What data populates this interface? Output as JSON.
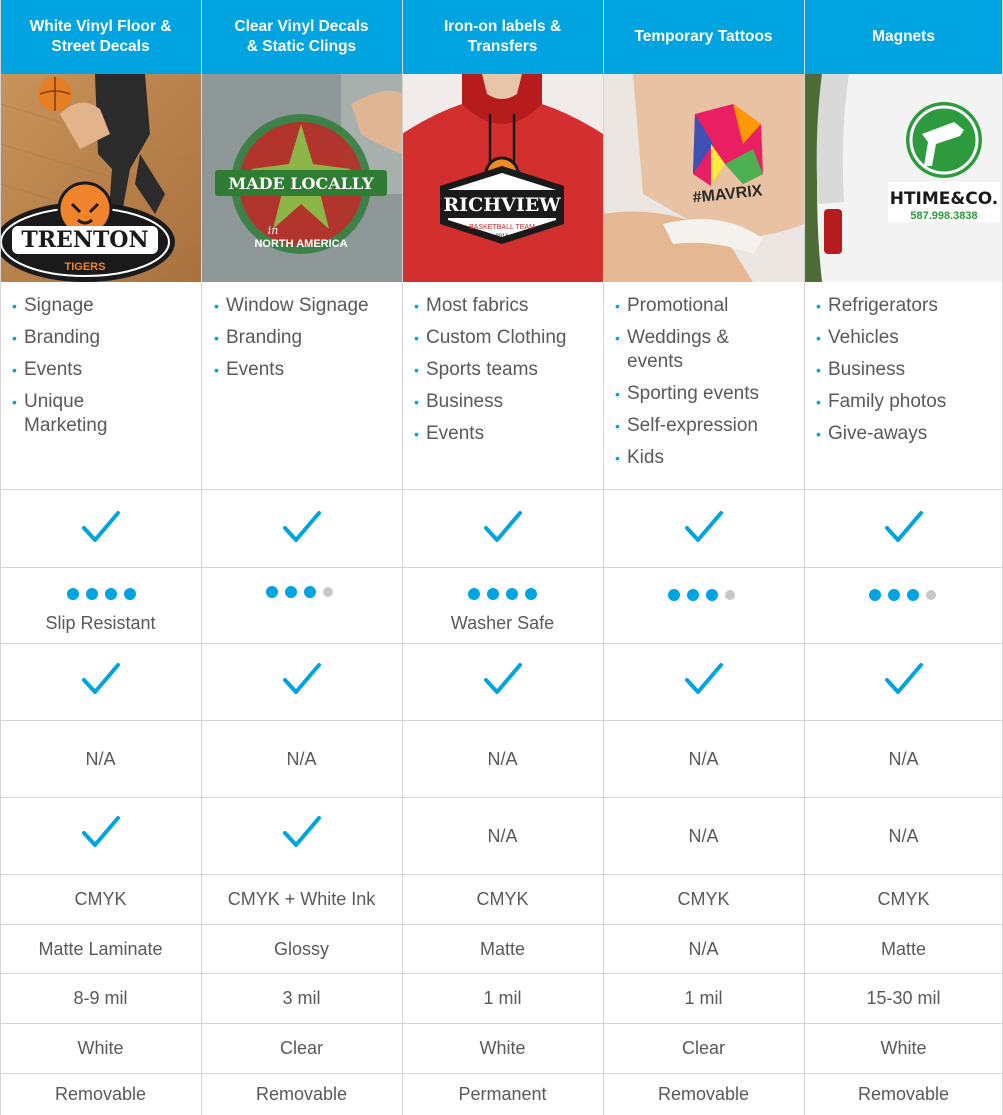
{
  "accent_color": "#00a4e0",
  "columns": [
    {
      "header": "White Vinyl Floor &\nStreet Decals",
      "image": {
        "logo_text": "TRENTON",
        "sub_text": "TIGERS"
      },
      "uses": [
        "Signage",
        "Branding",
        "Events",
        "Unique\nMarketing"
      ],
      "outdoor": "check",
      "durability": {
        "level": 4,
        "of": 4,
        "note": "Slip Resistant"
      },
      "indoor": "check",
      "r6": "N/A",
      "r7": "check",
      "ink": "CMYK",
      "finish": "Matte Laminate",
      "thickness": "8-9 mil",
      "material": "White",
      "adhesive": "Removable"
    },
    {
      "header": "Clear Vinyl Decals\n& Static Clings",
      "image": {
        "logo_text": "MADE LOCALLY",
        "sub_text": "in",
        "sub_text2": "NORTH AMERICA"
      },
      "uses": [
        "Window Signage",
        "Branding",
        "Events"
      ],
      "outdoor": "check",
      "durability": {
        "level": 3,
        "of": 4,
        "note": ""
      },
      "indoor": "check",
      "r6": "N/A",
      "r7": "check",
      "ink": "CMYK + White Ink",
      "finish": "Glossy",
      "thickness": "3 mil",
      "material": "Clear",
      "adhesive": "Removable"
    },
    {
      "header": "Iron-on labels &\nTransfers",
      "image": {
        "logo_text": "RICHVIEW",
        "sub_text": "BASKETBALL TEAM",
        "sub_text2": "2016"
      },
      "uses": [
        "Most fabrics",
        "Custom Clothing",
        "Sports teams",
        "Business",
        "Events"
      ],
      "outdoor": "check",
      "durability": {
        "level": 4,
        "of": 4,
        "note": "Washer Safe"
      },
      "indoor": "check",
      "r6": "N/A",
      "r7": "N/A",
      "ink": "CMYK",
      "finish": "Matte",
      "thickness": "1 mil",
      "material": "White",
      "adhesive": "Permanent"
    },
    {
      "header": "Temporary Tattoos",
      "image": {
        "logo_text": "#MAVRIX"
      },
      "uses": [
        "Promotional",
        "Weddings &\nevents",
        "Sporting events",
        "Self-expression",
        "Kids"
      ],
      "outdoor": "check",
      "durability": {
        "level": 3,
        "of": 4,
        "note": ""
      },
      "indoor": "check",
      "r6": "N/A",
      "r7": "N/A",
      "ink": "CMYK",
      "finish": "N/A",
      "thickness": "1 mil",
      "material": "Clear",
      "adhesive": "Removable"
    },
    {
      "header": "Magnets",
      "image": {
        "logo_text": "HTIME&CO.",
        "sub_text": "587.998.3838"
      },
      "uses": [
        "Refrigerators",
        "Vehicles",
        "Business",
        "Family photos",
        "Give-aways"
      ],
      "outdoor": "check",
      "durability": {
        "level": 3,
        "of": 4,
        "note": ""
      },
      "indoor": "check",
      "r6": "N/A",
      "r7": "N/A",
      "ink": "CMYK",
      "finish": "Matte",
      "thickness": "15-30 mil",
      "material": "White",
      "adhesive": "Removable"
    }
  ]
}
